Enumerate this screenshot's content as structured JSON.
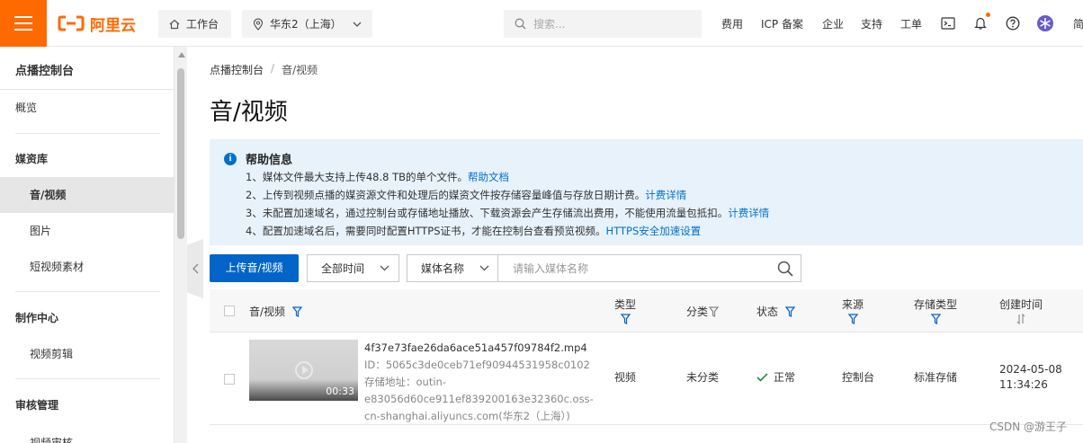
{
  "topbar": {
    "logo_text": "阿里云",
    "workbench": "工作台",
    "region": "华东2（上海）",
    "search_placeholder": "搜索...",
    "nav": [
      "费用",
      "ICP 备案",
      "企业",
      "支持",
      "工单"
    ],
    "truncated_right": "简",
    "brand_color": "#ff6a00"
  },
  "sidebar": {
    "title": "点播控制台",
    "overview": "概览",
    "group_media": "媒资库",
    "items_media": [
      "音/视频",
      "图片",
      "短视频素材"
    ],
    "group_production": "制作中心",
    "items_production": [
      "视频剪辑"
    ],
    "group_review": "审核管理",
    "items_review": [
      "视频审核"
    ],
    "active_item": "音/视频"
  },
  "breadcrumb": {
    "root": "点播控制台",
    "separator": "/",
    "current": "音/视频"
  },
  "page_title": "音/视频",
  "help": {
    "title": "帮助信息",
    "lines": [
      {
        "text": "1、媒体文件最大支持上传48.8 TB的单个文件。",
        "link": "帮助文档"
      },
      {
        "text": "2、上传到视频点播的媒资源文件和处理后的媒资文件按存储容量峰值与存放日期计费。",
        "link": "计费详情"
      },
      {
        "text": "3、未配置加速域名，通过控制台或存储地址播放、下载资源会产生存储流出费用，不能使用流量包抵扣。",
        "link": "计费详情"
      },
      {
        "text": "4、配置加速域名后，需要同时配置HTTPS证书，才能在控制台查看预览视频。",
        "link": "HTTPS安全加速设置"
      }
    ],
    "accent": "#0070cc"
  },
  "toolbar": {
    "upload_label": "上传音/视频",
    "time_select": "全部时间",
    "field_select": "媒体名称",
    "search_placeholder": "请输入媒体名称"
  },
  "table": {
    "headers": {
      "media": "音/视频",
      "type": "类型",
      "category": "分类",
      "status": "状态",
      "source": "来源",
      "storage_type": "存储类型",
      "created": "创建时间"
    },
    "rows": [
      {
        "duration": "00:33",
        "filename": "4f37e73fae26da6ace51a457f09784f2.mp4",
        "id_line": "ID：5065c3de0ceb71ef90944531958c0102",
        "storage_line1": "存储地址：outin-",
        "storage_line2": "e83056d60ce911ef839200163e32360c.oss-",
        "storage_line3": "cn-shanghai.aliyuncs.com(华东2（上海）)",
        "type": "视频",
        "category": "未分类",
        "status": "正常",
        "source": "控制台",
        "storage_type": "标准存储",
        "created_date": "2024-05-08",
        "created_time": "11:34:26"
      }
    ]
  },
  "watermark": "CSDN @游王子"
}
